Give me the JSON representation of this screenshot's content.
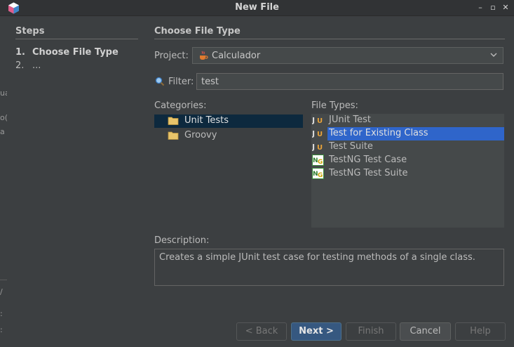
{
  "window": {
    "title": "New File",
    "min": "–",
    "max": "▫",
    "close": "✕"
  },
  "left_edge": [
    "ua",
    "o(",
    "a",
    "/",
    ":",
    ":"
  ],
  "steps": {
    "title": "Steps",
    "items": [
      {
        "num": "1.",
        "label": "Choose File Type"
      },
      {
        "num": "2.",
        "label": "..."
      }
    ]
  },
  "main": {
    "title": "Choose File Type",
    "project_label": "Project:",
    "project_value": "Calculador",
    "filter_label": "Filter:",
    "filter_value": "test",
    "categories_label": "Categories:",
    "categories": [
      {
        "label": "Unit Tests",
        "selected": true
      },
      {
        "label": "Groovy",
        "selected": false
      }
    ],
    "file_types_label": "File Types:",
    "file_types": [
      {
        "label": "JUnit Test",
        "icon": "junit-icon",
        "selected": false
      },
      {
        "label": "Test for Existing Class",
        "icon": "junit-icon",
        "selected": true
      },
      {
        "label": "Test Suite",
        "icon": "junit-icon",
        "selected": false
      },
      {
        "label": "TestNG Test Case",
        "icon": "testng-icon",
        "selected": false
      },
      {
        "label": "TestNG Test Suite",
        "icon": "testng-icon",
        "selected": false
      }
    ],
    "description_label": "Description:",
    "description": "Creates a simple JUnit test case for testing methods of a single class."
  },
  "buttons": {
    "back": "< Back",
    "next": "Next >",
    "finish": "Finish",
    "cancel": "Cancel",
    "help": "Help"
  },
  "colors": {
    "accent": "#2f65ca",
    "background": "#3c3f41"
  }
}
